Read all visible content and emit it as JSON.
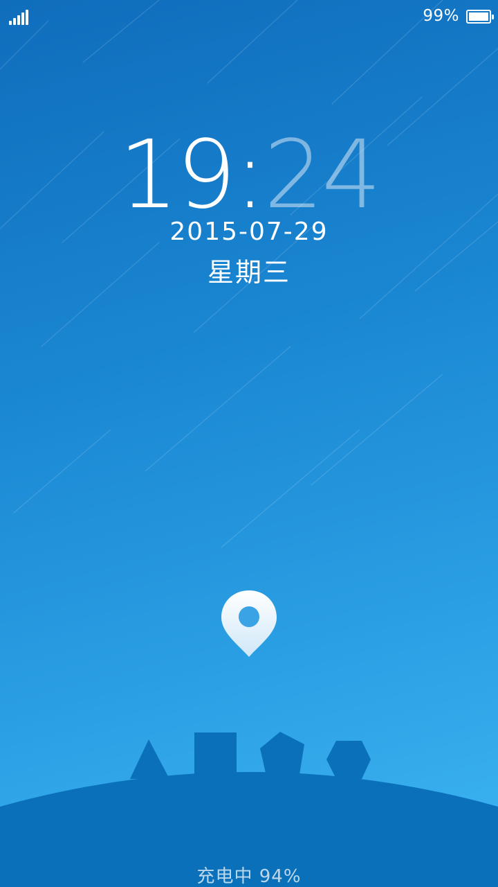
{
  "status_bar": {
    "battery_percent_text": "99%",
    "signal_icon": "cellular-signal-icon",
    "battery_icon": "battery-icon",
    "battery_level": 0.99
  },
  "lock_screen": {
    "time_hours": "19",
    "time_separator": ":",
    "time_minutes": "24",
    "date": "2015-07-29",
    "weekday": "星期三",
    "location_icon": "map-pin-icon",
    "charging_text": "充电中 94%"
  },
  "colors": {
    "sky_top": "#0f6dbc",
    "sky_bottom": "#3db5f2",
    "ground": "#0a70b9",
    "text": "#ffffff"
  }
}
